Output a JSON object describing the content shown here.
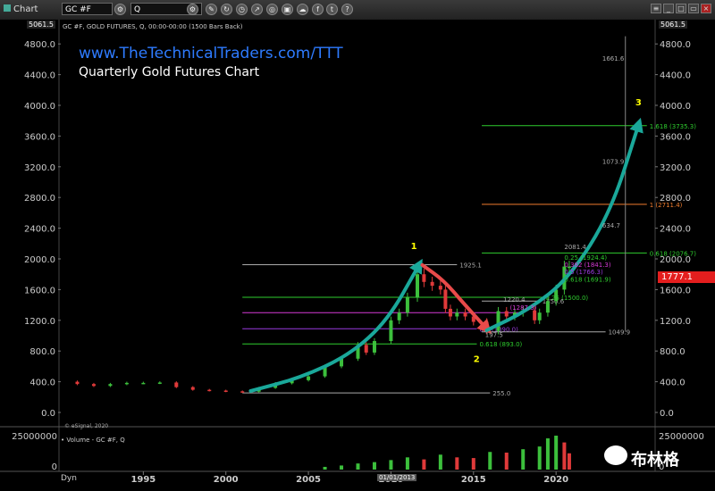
{
  "toolbar": {
    "chart_label": "Chart",
    "symbol_value": "GC #F",
    "interval_value": "Q",
    "icons": [
      "search-icon",
      "pencil-icon",
      "refresh-icon",
      "clock-icon",
      "share-icon",
      "chart-icon",
      "cloud-icon",
      "facebook-icon",
      "twitter-icon",
      "help-icon"
    ]
  },
  "header": {
    "info_line": "GC #F, GOLD FUTURES, Q, 00:00-00:00 (1500 Bars Back)",
    "site_title": "www.TheTechnicalTraders.com/TTT",
    "chart_subtitle": "Quarterly Gold Futures Chart",
    "esignal": "© eSignal, 2020",
    "volume_label": "• Volume - GC #F, Q",
    "watermark": "布林格",
    "dyn_label": "Dyn",
    "date_marker": "01/01/2013"
  },
  "colors": {
    "background": "#000000",
    "arrow_up": "#1aa89a",
    "arrow_down": "#e84a4a",
    "up_candle": "#3cbf3c",
    "down_candle": "#e03a3a",
    "site_title": "#2e7bff",
    "wave_label": "#ffff00",
    "price_tag": "#e41e1e"
  },
  "chart_data": {
    "type": "candlestick",
    "ylim": [
      0,
      5061.5
    ],
    "top_label": "5061.5",
    "yticks": [
      0,
      400,
      800,
      1200,
      1600,
      2000,
      2400,
      2800,
      3200,
      3600,
      4000,
      4400,
      4800
    ],
    "ytick_labels": [
      "0.0",
      "400.0",
      "800.0",
      "1200.0",
      "1600.0",
      "2000.0",
      "2400.0",
      "2800.0",
      "3200.0",
      "3600.0",
      "4000.0",
      "4400.0",
      "4800.0"
    ],
    "xlim": [
      1990.0,
      2026.0
    ],
    "xticks": [
      1995,
      2000,
      2005,
      2010,
      2015,
      2020
    ],
    "current_price": "1777.1",
    "volume_axis_labels": [
      "25000000",
      "0"
    ],
    "price_series": [
      [
        1990.0,
        400
      ],
      [
        1991.0,
        370
      ],
      [
        1992.0,
        345
      ],
      [
        1993.0,
        370
      ],
      [
        1994.0,
        385
      ],
      [
        1995.0,
        385
      ],
      [
        1996.0,
        390
      ],
      [
        1997.0,
        330
      ],
      [
        1998.0,
        295
      ],
      [
        1999.0,
        285
      ],
      [
        2000.0,
        275
      ],
      [
        2001.0,
        270
      ],
      [
        2002.0,
        320
      ],
      [
        2003.0,
        380
      ],
      [
        2004.0,
        420
      ],
      [
        2005.0,
        470
      ],
      [
        2006.0,
        600
      ],
      [
        2007.0,
        700
      ],
      [
        2008.0,
        880
      ],
      [
        2008.5,
        780
      ],
      [
        2009.0,
        930
      ],
      [
        2010.0,
        1200
      ],
      [
        2010.5,
        1300
      ],
      [
        2011.0,
        1500
      ],
      [
        2011.6,
        1800
      ],
      [
        2012.0,
        1700
      ],
      [
        2012.5,
        1650
      ],
      [
        2013.0,
        1600
      ],
      [
        2013.3,
        1350
      ],
      [
        2013.6,
        1250
      ],
      [
        2014.0,
        1300
      ],
      [
        2014.5,
        1250
      ],
      [
        2015.0,
        1180
      ],
      [
        2015.8,
        1060
      ],
      [
        2016.5,
        1320
      ],
      [
        2017.0,
        1250
      ],
      [
        2017.5,
        1300
      ],
      [
        2018.0,
        1330
      ],
      [
        2018.7,
        1200
      ],
      [
        2019.0,
        1300
      ],
      [
        2019.5,
        1450
      ],
      [
        2020.0,
        1600
      ],
      [
        2020.5,
        1900
      ],
      [
        2020.8,
        1900
      ]
    ],
    "volume_series": [
      [
        2006.0,
        2000000
      ],
      [
        2007.0,
        3000000
      ],
      [
        2008.0,
        4500000
      ],
      [
        2009.0,
        5500000
      ],
      [
        2010.0,
        7000000
      ],
      [
        2011.0,
        9000000
      ],
      [
        2012.0,
        7500000
      ],
      [
        2013.0,
        11000000
      ],
      [
        2014.0,
        9000000
      ],
      [
        2015.0,
        8500000
      ],
      [
        2016.0,
        13000000
      ],
      [
        2017.0,
        12500000
      ],
      [
        2018.0,
        15000000
      ],
      [
        2019.0,
        17000000
      ],
      [
        2019.5,
        23000000
      ],
      [
        2020.0,
        25000000
      ],
      [
        2020.5,
        20000000
      ],
      [
        2020.8,
        12000000
      ]
    ],
    "levels": [
      {
        "price": 1925.1,
        "x0": 2001.0,
        "x1": 2014.0,
        "label": "1925.1",
        "color": "#aaaaaa"
      },
      {
        "price": 1500.0,
        "x0": 2001.0,
        "x1": 2019.2,
        "label": "0.25 (1500.0)",
        "color": "#2ecc2e"
      },
      {
        "price": 1300.0,
        "x0": 2001.0,
        "x1": 2018.0,
        "label": "",
        "color": "#d63ad6"
      },
      {
        "price": 1090.0,
        "x0": 2001.0,
        "x1": 2015.2,
        "label": "0.5 (1090.0)",
        "color": "#9a3adf"
      },
      {
        "price": 893.0,
        "x0": 2001.0,
        "x1": 2015.2,
        "label": "0.618 (893.0)",
        "color": "#2ecc2e"
      },
      {
        "price": 255.0,
        "x0": 2001.0,
        "x1": 2016.0,
        "label": "255.0",
        "color": "#aaaaaa"
      },
      {
        "price": 1049.9,
        "x0": 2015.5,
        "x1": 2023.0,
        "label": "1049.9",
        "color": "#aaaaaa"
      },
      {
        "price": 1450.6,
        "x0": 2015.5,
        "x1": 2019.0,
        "label": "1450.6",
        "color": "#aaaaaa"
      },
      {
        "price": 3735.3,
        "x0": 2015.5,
        "x1": 2025.5,
        "label": "1.618 (3735.3)",
        "color": "#2ecc2e"
      },
      {
        "price": 2711.4,
        "x0": 2015.5,
        "x1": 2025.5,
        "label": "1 (2711.4)",
        "color": "#f07d2e"
      },
      {
        "price": 2076.7,
        "x0": 2015.5,
        "x1": 2025.5,
        "label": "0.618 (2076.7)",
        "color": "#2ecc2e"
      }
    ],
    "annotations": [
      {
        "x": 2022.8,
        "price": 4580,
        "text": "1661.6",
        "color": "#aaaaaa"
      },
      {
        "x": 2022.8,
        "price": 3240,
        "text": "1073.9",
        "color": "#aaaaaa"
      },
      {
        "x": 2022.8,
        "price": 2405,
        "text": "634.7",
        "color": "#aaaaaa"
      },
      {
        "x": 2020.5,
        "price": 2130,
        "text": "2081.4",
        "color": "#aaaaaa"
      },
      {
        "x": 2020.5,
        "price": 1990,
        "text": "0.25 (1924.4)",
        "color": "#2ecc2e"
      },
      {
        "x": 2020.5,
        "price": 1895,
        "text": "0.382 (1841.3)",
        "color": "#d63ad6"
      },
      {
        "x": 2020.5,
        "price": 1800,
        "text": "0.5 (1766.3)",
        "color": "#9a3adf"
      },
      {
        "x": 2020.5,
        "price": 1705,
        "text": "0.618 (1691.9)",
        "color": "#2ecc2e"
      },
      {
        "x": 2016.8,
        "price": 1440,
        "text": "1220.4",
        "color": "#aaaaaa"
      },
      {
        "x": 2017.2,
        "price": 1335,
        "text": "(1287.3)",
        "color": "#d63ad6"
      },
      {
        "x": 2015.7,
        "price": 985,
        "text": "197.5",
        "color": "#aaaaaa"
      }
    ],
    "wave_labels": [
      {
        "x": 2011.2,
        "price": 2130,
        "text": "1"
      },
      {
        "x": 2015.0,
        "price": 655,
        "text": "2"
      },
      {
        "x": 2024.8,
        "price": 4000,
        "text": "3"
      }
    ],
    "arrows": [
      {
        "kind": "up",
        "points": [
          [
            2001.5,
            280
          ],
          [
            2004.5,
            450
          ],
          [
            2007.5,
            750
          ],
          [
            2009.8,
            1200
          ],
          [
            2011.7,
            1920
          ]
        ]
      },
      {
        "kind": "down",
        "points": [
          [
            2011.9,
            1920
          ],
          [
            2013.2,
            1720
          ],
          [
            2014.4,
            1420
          ],
          [
            2015.8,
            1090
          ]
        ]
      },
      {
        "kind": "up",
        "points": [
          [
            2015.8,
            1070
          ],
          [
            2018.3,
            1330
          ],
          [
            2020.8,
            1750
          ],
          [
            2023.3,
            2600
          ],
          [
            2025.0,
            3750
          ]
        ]
      }
    ]
  }
}
